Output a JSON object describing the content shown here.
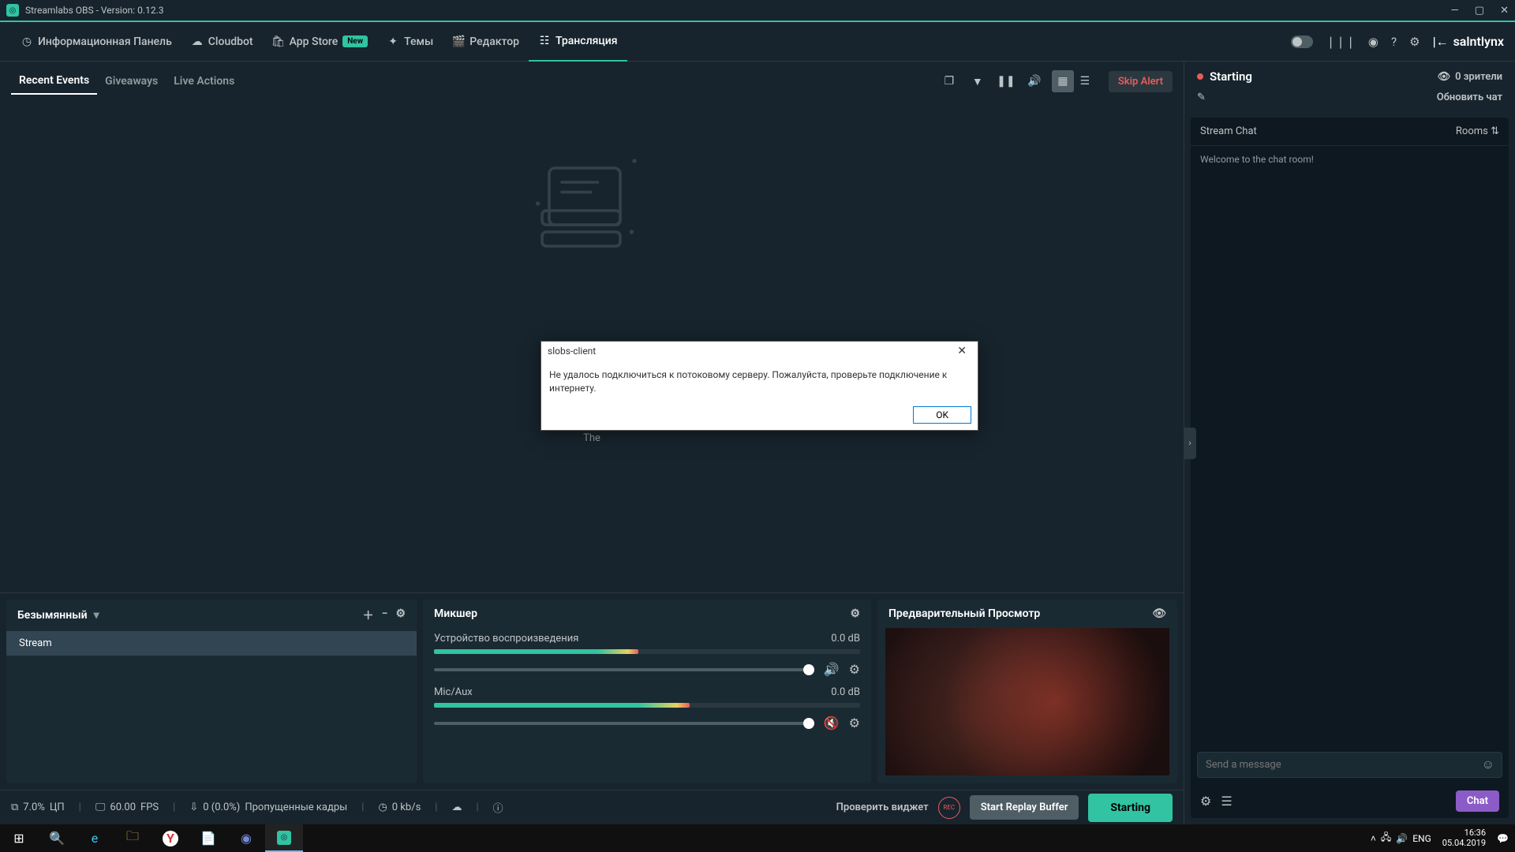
{
  "titlebar": {
    "title": "Streamlabs OBS - Version: 0.12.3"
  },
  "nav": {
    "items": [
      {
        "label": "Информационная Панель"
      },
      {
        "label": "Cloudbot"
      },
      {
        "label": "App Store",
        "badge": "New"
      },
      {
        "label": "Темы"
      },
      {
        "label": "Редактор"
      },
      {
        "label": "Трансляция"
      }
    ],
    "username": "salntlynx"
  },
  "events": {
    "tabs": {
      "recent": "Recent Events",
      "giveaways": "Giveaways",
      "live": "Live Actions"
    },
    "skip": "Skip Alert",
    "hint_prefix": "The"
  },
  "sources": {
    "title": "Безымянный",
    "item": "Stream"
  },
  "mixer": {
    "title": "Микшер",
    "rows": [
      {
        "name": "Устройство воспроизведения",
        "db": "0.0 dB",
        "muted": false
      },
      {
        "name": "Mic/Aux",
        "db": "0.0 dB",
        "muted": true
      }
    ]
  },
  "preview": {
    "title": "Предварительный Просмотр"
  },
  "status": {
    "cpu": "7.0%",
    "cpu_label": "ЦП",
    "fps": "60.00",
    "fps_label": "FPS",
    "dropped": "0 (0.0%)",
    "dropped_label": "Пропущенные кадры",
    "bitrate": "0 kb/s",
    "check_widget": "Проверить виджет",
    "rec": "REC",
    "replay": "Start Replay Buffer",
    "go_live": "Starting"
  },
  "right": {
    "starting": "Starting",
    "viewers": "0 зрители",
    "refresh": "Обновить чат",
    "chat_header": "Stream Chat",
    "rooms": "Rooms",
    "welcome": "Welcome to the chat room!",
    "input_placeholder": "Send a message",
    "chat_btn": "Chat"
  },
  "dialog": {
    "title": "slobs-client",
    "message": "Не удалось подключиться к потоковому серверу. Пожалуйста, проверьте подключение к интернету.",
    "ok": "OK"
  },
  "tray": {
    "lang": "ENG",
    "time": "16:36",
    "date": "05.04.2019"
  }
}
